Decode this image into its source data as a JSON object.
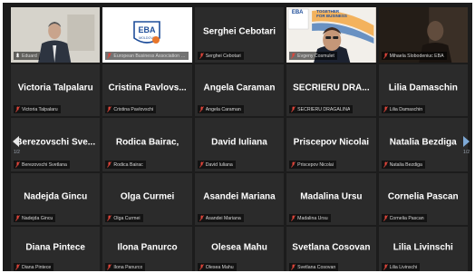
{
  "meeting": {
    "page_left": "1/2",
    "page_right": "1/2"
  },
  "tiles": [
    {
      "name": "",
      "label": "Eduard",
      "type": "video",
      "mic": "on"
    },
    {
      "name": "",
      "label": "European Business Association M...",
      "type": "logo",
      "mic": "off"
    },
    {
      "name": "Serghei Cebotari",
      "label": "Serghei Cebotari",
      "type": "name",
      "mic": "off"
    },
    {
      "name": "",
      "label": "Evgeny Cosmulet",
      "type": "video",
      "mic": "off"
    },
    {
      "name": "",
      "label": "Mihaela Slobodeniuc EBA",
      "type": "video",
      "mic": "off"
    },
    {
      "name": "Victoria Talpalaru",
      "label": "Victoria Talpalaru",
      "type": "name",
      "mic": "off"
    },
    {
      "name": "Cristina Pavlovs...",
      "label": "Cristina Pavlovschi",
      "type": "name",
      "mic": "off"
    },
    {
      "name": "Angela Caraman",
      "label": "Angela Caraman",
      "type": "name",
      "mic": "off"
    },
    {
      "name": "SECRIERU DRA...",
      "label": "SECRIERU DRAGALINA",
      "type": "name",
      "mic": "off"
    },
    {
      "name": "Lilia Damaschin",
      "label": "Lilia Damaschin",
      "type": "name",
      "mic": "off"
    },
    {
      "name": "Berezovschi Sve...",
      "label": "Berezovschi Svetlana",
      "type": "name",
      "mic": "off"
    },
    {
      "name": "Rodica Bairac,",
      "label": "Rodica Bairac",
      "type": "name",
      "mic": "off"
    },
    {
      "name": "David Iuliana",
      "label": "David Iuliana",
      "type": "name",
      "mic": "off"
    },
    {
      "name": "Priscepov Nicolai",
      "label": "Priscepov Nicolai",
      "type": "name",
      "mic": "off"
    },
    {
      "name": "Natalia Bezdiga",
      "label": "Natalia Bezdiga",
      "type": "name",
      "mic": "off"
    },
    {
      "name": "Nadejda Gincu",
      "label": "Nadejda Gincu",
      "type": "name",
      "mic": "off"
    },
    {
      "name": "Olga Curmei",
      "label": "Olga Curmei",
      "type": "name",
      "mic": "off"
    },
    {
      "name": "Asandei Mariana",
      "label": "Asandei Mariana",
      "type": "name",
      "mic": "off"
    },
    {
      "name": "Madalina Ursu",
      "label": "Madalina Ursu",
      "type": "name",
      "mic": "off"
    },
    {
      "name": "Cornelia Pascan",
      "label": "Cornelia Pascan",
      "type": "name",
      "mic": "off"
    },
    {
      "name": "Diana Pintece",
      "label": "Diana Pintece",
      "type": "name",
      "mic": "off"
    },
    {
      "name": "Ilona Panurco",
      "label": "Ilona Panurco",
      "type": "name",
      "mic": "off"
    },
    {
      "name": "Olesea Mahu",
      "label": "Olesea Mahu",
      "type": "name",
      "mic": "off"
    },
    {
      "name": "Svetlana Cosovan",
      "label": "Svetlana Cosovan",
      "type": "name",
      "mic": "off"
    },
    {
      "name": "Lilia Livinschi",
      "label": "Lilia Livinschi",
      "type": "name",
      "mic": "off"
    }
  ],
  "logo": {
    "text": "EBA",
    "subtext": "MOLDOVA",
    "banner_line1": "TOGETHER",
    "banner_line2": "FOR BUSINESS"
  },
  "colors": {
    "tile_bg": "#2b2b2b",
    "active_border": "#e9d95a",
    "muted_mic": "#e0453a",
    "page_arrow": "#7ea9d6"
  }
}
